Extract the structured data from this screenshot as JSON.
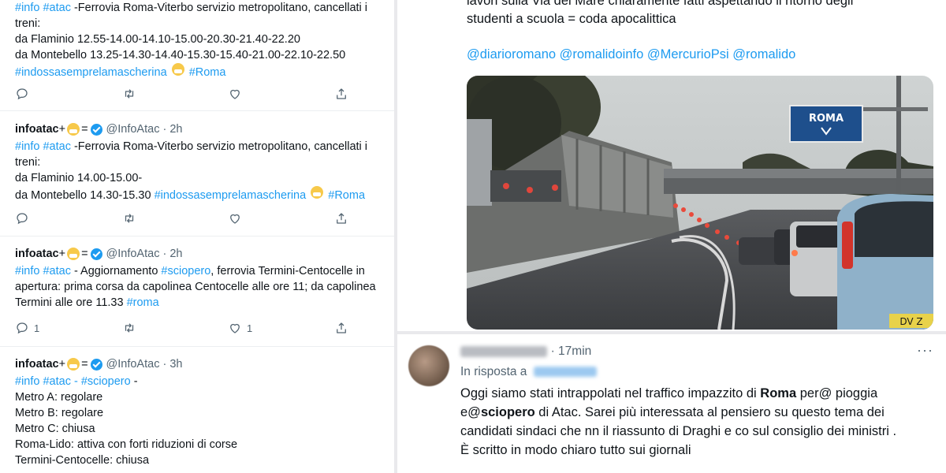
{
  "tweet1": {
    "line1_tags": "#info #atac",
    "line1_text": " -Ferrovia Roma-Viterbo servizio metropolitano, cancellati i",
    "line2": "treni:",
    "line3": "da Flaminio 12.55-14.00-14.10-15.00-20.30-21.40-22.20",
    "line4": "da Montebello 13.25-14.30-14.40-15.30-15.40-21.00-22.10-22.50",
    "line5_tag": "#indossasemprelamascherina",
    "line5_tag2": "#Roma"
  },
  "tweet2": {
    "name": "infoatac",
    "plus": " +",
    "eq": "=",
    "handle": "@InfoAtac · 2h",
    "line1_tags": "#info #atac",
    "line1_text": " -Ferrovia Roma-Viterbo servizio metropolitano, cancellati i",
    "line2": "treni:",
    "line3": "da Flaminio 14.00-15.00-",
    "line4_text": "da Montebello 14.30-15.30 ",
    "line4_tag": "#indossasemprelamascherina",
    "line4_tag2": "#Roma"
  },
  "tweet3": {
    "name": "infoatac",
    "plus": " +",
    "eq": "=",
    "handle": "@InfoAtac · 2h",
    "line1_tags": "#info #atac",
    "line1_text": " - Aggiornamento ",
    "line1_tag": "#sciopero",
    "line1_text2": ", ferrovia Termini-Centocelle in",
    "line2": "apertura: prima corsa da capolinea Centocelle alle ore 11; da capolinea",
    "line3_text": "Termini alle ore 11.33 ",
    "line3_tag": "#roma",
    "reply_count": "1",
    "like_count": "1"
  },
  "tweet4": {
    "name": "infoatac",
    "plus": " +",
    "eq": "=",
    "handle": "@InfoAtac · 3h",
    "line1_tags": "#info #atac - #sciopero",
    "line1_text": " -",
    "lines": [
      "Metro A: regolare",
      "Metro B: regolare",
      "Metro C: chiusa",
      "Roma-Lido: attiva con forti riduzioni di corse",
      "Termini-Centocelle: chiusa"
    ]
  },
  "rt": {
    "line1": "lavori sulla Via del Mare chiaramente fatti aspettando il ritorno degli",
    "line2": "studenti a scuola = coda apocalittica",
    "mentions": "@diarioromano @romalidoinfo @MercurioPsi @romalido",
    "sign_text": "ROMA",
    "plate_text": "DV Z"
  },
  "reply": {
    "time": "· 17min",
    "in_reply": "In risposta a",
    "more": "···",
    "l1a": "Oggi siamo stati intrappolati nel traffico  impazzito di ",
    "l1b": "Roma",
    "l1c": " per@ pioggia",
    "l2a": "e@",
    "l2b": "sciopero",
    "l2c": " di Atac. Sarei più interessata al pensiero su questo tema dei",
    "l3": "candidati sindaci che nn il riassunto di Draghi e co sul consiglio dei ministri .",
    "l4": "È scritto in modo chiaro tutto sui giornali"
  },
  "colors": {
    "link": "#1d9bf0",
    "muted": "#536471",
    "verified": "#1d9bf0"
  },
  "icons": [
    "reply-icon",
    "retweet-icon",
    "like-icon",
    "share-icon",
    "verified-icon",
    "mask-emoji-icon",
    "more-icon"
  ]
}
